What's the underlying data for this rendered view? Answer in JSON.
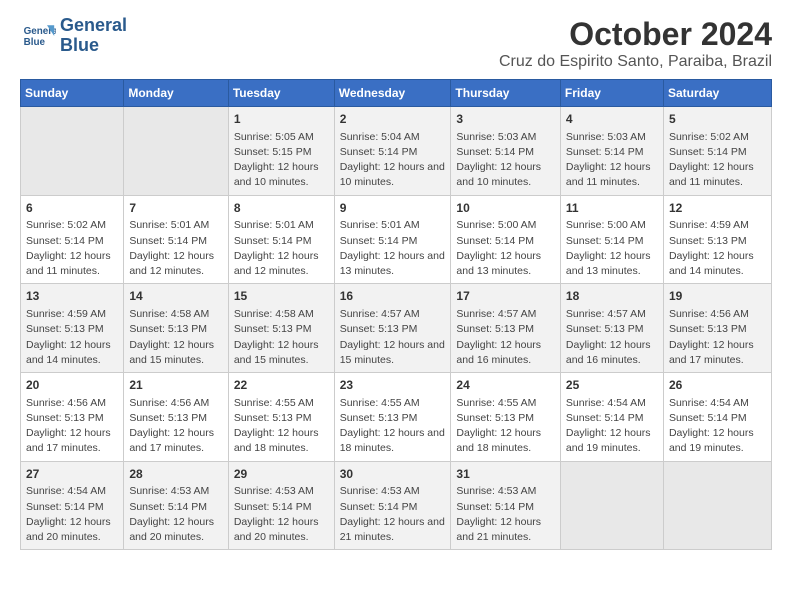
{
  "logo": {
    "line1": "General",
    "line2": "Blue"
  },
  "title": "October 2024",
  "subtitle": "Cruz do Espirito Santo, Paraiba, Brazil",
  "days_of_week": [
    "Sunday",
    "Monday",
    "Tuesday",
    "Wednesday",
    "Thursday",
    "Friday",
    "Saturday"
  ],
  "weeks": [
    [
      {
        "day": "",
        "info": ""
      },
      {
        "day": "",
        "info": ""
      },
      {
        "day": "1",
        "info": "Sunrise: 5:05 AM\nSunset: 5:15 PM\nDaylight: 12 hours and 10 minutes."
      },
      {
        "day": "2",
        "info": "Sunrise: 5:04 AM\nSunset: 5:14 PM\nDaylight: 12 hours and 10 minutes."
      },
      {
        "day": "3",
        "info": "Sunrise: 5:03 AM\nSunset: 5:14 PM\nDaylight: 12 hours and 10 minutes."
      },
      {
        "day": "4",
        "info": "Sunrise: 5:03 AM\nSunset: 5:14 PM\nDaylight: 12 hours and 11 minutes."
      },
      {
        "day": "5",
        "info": "Sunrise: 5:02 AM\nSunset: 5:14 PM\nDaylight: 12 hours and 11 minutes."
      }
    ],
    [
      {
        "day": "6",
        "info": "Sunrise: 5:02 AM\nSunset: 5:14 PM\nDaylight: 12 hours and 11 minutes."
      },
      {
        "day": "7",
        "info": "Sunrise: 5:01 AM\nSunset: 5:14 PM\nDaylight: 12 hours and 12 minutes."
      },
      {
        "day": "8",
        "info": "Sunrise: 5:01 AM\nSunset: 5:14 PM\nDaylight: 12 hours and 12 minutes."
      },
      {
        "day": "9",
        "info": "Sunrise: 5:01 AM\nSunset: 5:14 PM\nDaylight: 12 hours and 13 minutes."
      },
      {
        "day": "10",
        "info": "Sunrise: 5:00 AM\nSunset: 5:14 PM\nDaylight: 12 hours and 13 minutes."
      },
      {
        "day": "11",
        "info": "Sunrise: 5:00 AM\nSunset: 5:14 PM\nDaylight: 12 hours and 13 minutes."
      },
      {
        "day": "12",
        "info": "Sunrise: 4:59 AM\nSunset: 5:13 PM\nDaylight: 12 hours and 14 minutes."
      }
    ],
    [
      {
        "day": "13",
        "info": "Sunrise: 4:59 AM\nSunset: 5:13 PM\nDaylight: 12 hours and 14 minutes."
      },
      {
        "day": "14",
        "info": "Sunrise: 4:58 AM\nSunset: 5:13 PM\nDaylight: 12 hours and 15 minutes."
      },
      {
        "day": "15",
        "info": "Sunrise: 4:58 AM\nSunset: 5:13 PM\nDaylight: 12 hours and 15 minutes."
      },
      {
        "day": "16",
        "info": "Sunrise: 4:57 AM\nSunset: 5:13 PM\nDaylight: 12 hours and 15 minutes."
      },
      {
        "day": "17",
        "info": "Sunrise: 4:57 AM\nSunset: 5:13 PM\nDaylight: 12 hours and 16 minutes."
      },
      {
        "day": "18",
        "info": "Sunrise: 4:57 AM\nSunset: 5:13 PM\nDaylight: 12 hours and 16 minutes."
      },
      {
        "day": "19",
        "info": "Sunrise: 4:56 AM\nSunset: 5:13 PM\nDaylight: 12 hours and 17 minutes."
      }
    ],
    [
      {
        "day": "20",
        "info": "Sunrise: 4:56 AM\nSunset: 5:13 PM\nDaylight: 12 hours and 17 minutes."
      },
      {
        "day": "21",
        "info": "Sunrise: 4:56 AM\nSunset: 5:13 PM\nDaylight: 12 hours and 17 minutes."
      },
      {
        "day": "22",
        "info": "Sunrise: 4:55 AM\nSunset: 5:13 PM\nDaylight: 12 hours and 18 minutes."
      },
      {
        "day": "23",
        "info": "Sunrise: 4:55 AM\nSunset: 5:13 PM\nDaylight: 12 hours and 18 minutes."
      },
      {
        "day": "24",
        "info": "Sunrise: 4:55 AM\nSunset: 5:13 PM\nDaylight: 12 hours and 18 minutes."
      },
      {
        "day": "25",
        "info": "Sunrise: 4:54 AM\nSunset: 5:14 PM\nDaylight: 12 hours and 19 minutes."
      },
      {
        "day": "26",
        "info": "Sunrise: 4:54 AM\nSunset: 5:14 PM\nDaylight: 12 hours and 19 minutes."
      }
    ],
    [
      {
        "day": "27",
        "info": "Sunrise: 4:54 AM\nSunset: 5:14 PM\nDaylight: 12 hours and 20 minutes."
      },
      {
        "day": "28",
        "info": "Sunrise: 4:53 AM\nSunset: 5:14 PM\nDaylight: 12 hours and 20 minutes."
      },
      {
        "day": "29",
        "info": "Sunrise: 4:53 AM\nSunset: 5:14 PM\nDaylight: 12 hours and 20 minutes."
      },
      {
        "day": "30",
        "info": "Sunrise: 4:53 AM\nSunset: 5:14 PM\nDaylight: 12 hours and 21 minutes."
      },
      {
        "day": "31",
        "info": "Sunrise: 4:53 AM\nSunset: 5:14 PM\nDaylight: 12 hours and 21 minutes."
      },
      {
        "day": "",
        "info": ""
      },
      {
        "day": "",
        "info": ""
      }
    ]
  ]
}
